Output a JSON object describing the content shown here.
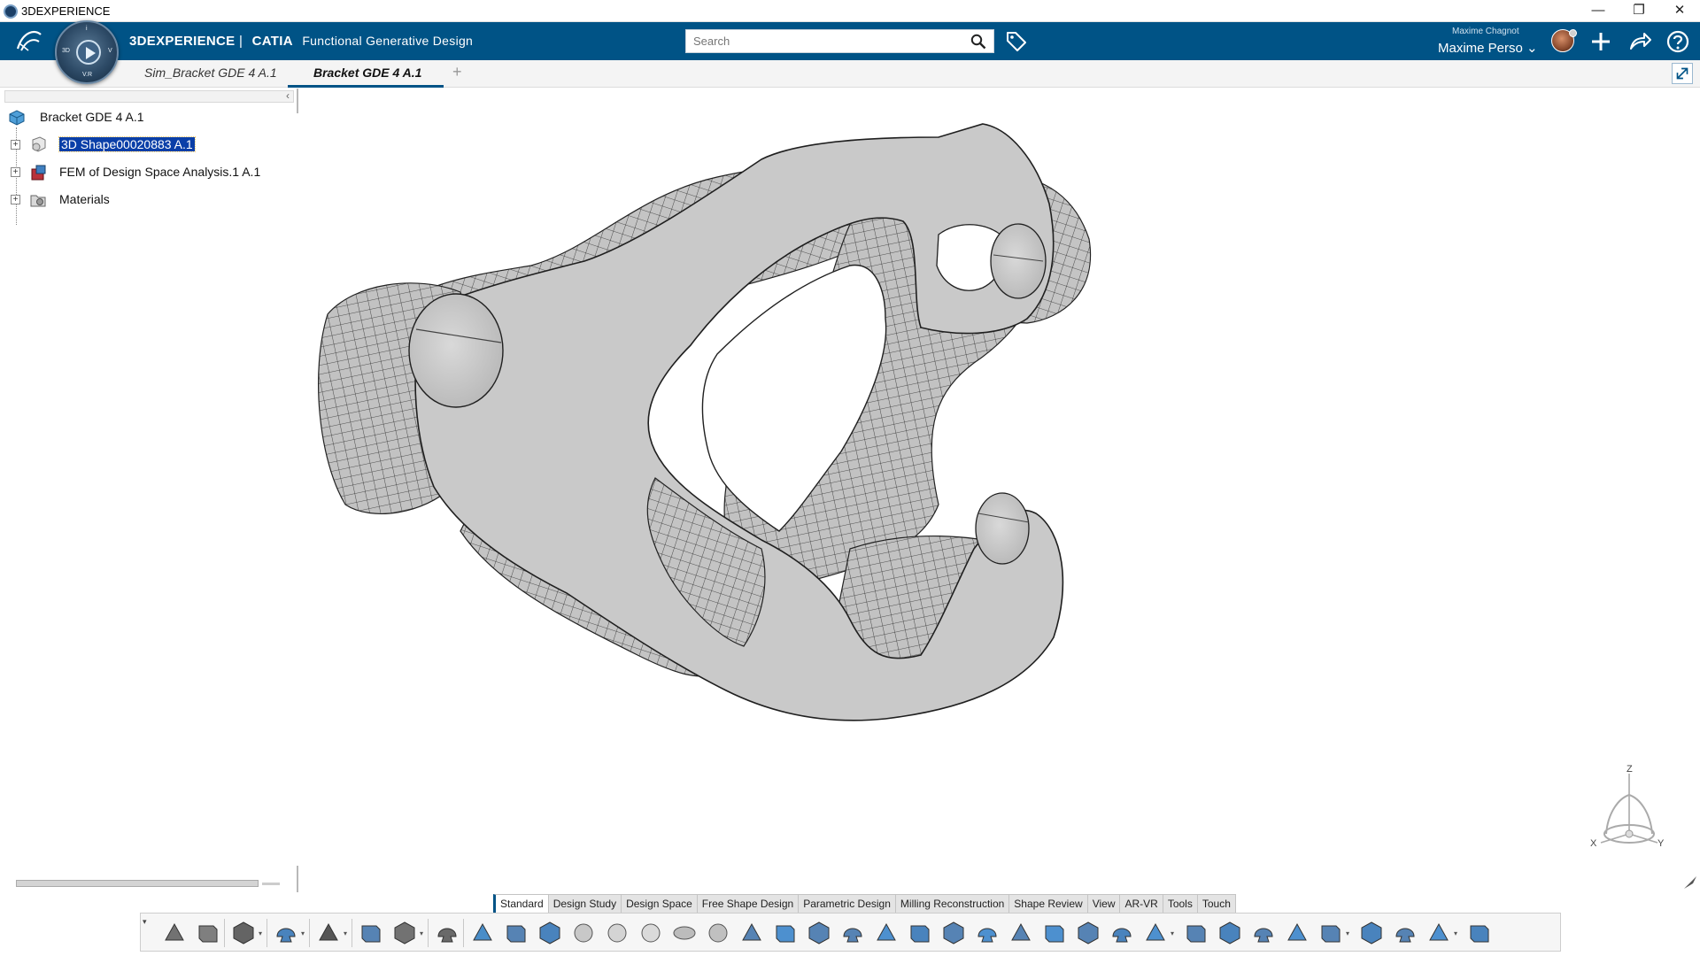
{
  "window": {
    "title": "3DEXPERIENCE",
    "minimize": "—",
    "restore": "❐",
    "close": "✕"
  },
  "topbar": {
    "brand_3d": "3DEXPERIENCE",
    "brand_sep": "|",
    "brand_app": "CATIA",
    "brand_role": "Functional Generative Design",
    "compass_labels": {
      "top": "i",
      "left": "3D",
      "bottom": "V.R",
      "right": "V"
    },
    "search_placeholder": "Search",
    "user_small": "Maxime Chagnot",
    "user_name": "Maxime Perso",
    "user_caret": "⌄"
  },
  "tabs": {
    "items": [
      {
        "label": "Sim_Bracket GDE 4 A.1",
        "active": false
      },
      {
        "label": "Bracket GDE 4 A.1",
        "active": true
      }
    ],
    "add": "+"
  },
  "tree": {
    "collapse": "‹",
    "root": "Bracket GDE 4 A.1",
    "children": [
      {
        "label": "3D Shape00020883 A.1",
        "selected": true,
        "icon": "3d-shape-icon"
      },
      {
        "label": "FEM of Design Space Analysis.1 A.1",
        "selected": false,
        "icon": "fem-icon"
      },
      {
        "label": "Materials",
        "selected": false,
        "icon": "materials-icon"
      }
    ],
    "expander": "+"
  },
  "compass3d": {
    "z": "Z",
    "x": "X",
    "y": "Y"
  },
  "section_tabs": [
    {
      "label": "Standard",
      "active": true
    },
    {
      "label": "Design Study",
      "active": false
    },
    {
      "label": "Design Space",
      "active": false
    },
    {
      "label": "Free Shape Design",
      "active": false
    },
    {
      "label": "Parametric Design",
      "active": false
    },
    {
      "label": "Milling Reconstruction",
      "active": false
    },
    {
      "label": "Shape Review",
      "active": false
    },
    {
      "label": "View",
      "active": false
    },
    {
      "label": "AR-VR",
      "active": false
    },
    {
      "label": "Tools",
      "active": false
    },
    {
      "label": "Touch",
      "active": false
    }
  ],
  "toolbar": {
    "tools": [
      "cut-icon",
      "copy-icon",
      "paste-icon",
      "undo-icon",
      "update-icon",
      "select-icon",
      "measure-icon",
      "warning-icon",
      "part-design-icon",
      "sketch-icon",
      "pen-icon",
      "sphere-icon",
      "ellipsoid-icon",
      "box-icon",
      "torus-icon",
      "pyramid-icon",
      "surface-icon",
      "subdivision-icon",
      "shape-edit-icon",
      "deform-icon",
      "mesh-icon",
      "transform-icon",
      "sculpt-icon",
      "freeze-icon",
      "delete-mesh-icon",
      "smooth-icon",
      "fill-icon",
      "pattern-icon",
      "view-icon",
      "flatten-icon",
      "bridge-icon",
      "blend-icon",
      "thickness-icon",
      "lattice-icon",
      "offset-icon",
      "analyze-icon",
      "check-icon",
      "export-icon"
    ],
    "drop": "▾"
  }
}
